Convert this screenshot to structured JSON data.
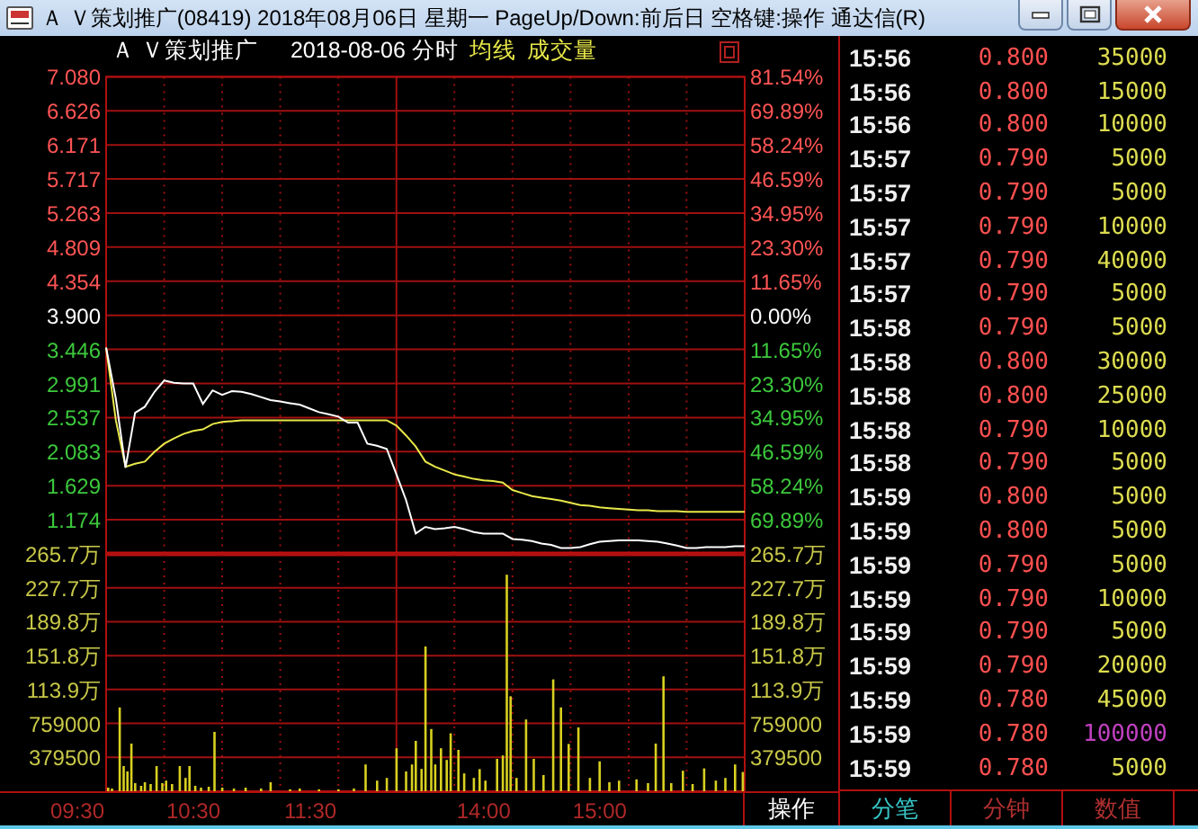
{
  "window": {
    "title": "Ａ Ｖ策划推广(08419) 2018年08月06日 星期一 PageUp/Down:前后日 空格键:操作 通达信(R)"
  },
  "chart_header": {
    "name": "Ａ Ｖ策划推广",
    "date_mode": "2018-08-06 分时"
  },
  "price_chart": {
    "chart_data": {
      "type": "line",
      "grid": true,
      "ylim": [
        0.72,
        7.08
      ],
      "categories": [
        null,
        null,
        null,
        null,
        null,
        null,
        null,
        null,
        null,
        null,
        null,
        null,
        null,
        null,
        null,
        null,
        null,
        null,
        null,
        null,
        null,
        null,
        null,
        null,
        null,
        null,
        null,
        null,
        null,
        null,
        null,
        null,
        null,
        null,
        null,
        null,
        null,
        null,
        null,
        null,
        null,
        null,
        null,
        null,
        null,
        null,
        null,
        null,
        null,
        null,
        null,
        null,
        null,
        null,
        null,
        null,
        null,
        null,
        null,
        null,
        null,
        null,
        null,
        null,
        null,
        null,
        null
      ],
      "yticks": [
        {
          "value": 7.08,
          "label": "7.080"
        },
        {
          "value": 6.626,
          "label": "6.626"
        },
        {
          "value": 6.171,
          "label": "6.171"
        },
        {
          "value": 5.717,
          "label": "5.717"
        },
        {
          "value": 5.263,
          "label": "5.263"
        },
        {
          "value": 4.809,
          "label": "4.809"
        },
        {
          "value": 4.354,
          "label": "4.354"
        },
        {
          "value": 3.9,
          "label": "3.900"
        },
        {
          "value": 3.446,
          "label": "3.446"
        },
        {
          "value": 2.991,
          "label": "2.991"
        },
        {
          "value": 2.537,
          "label": "2.537"
        },
        {
          "value": 2.083,
          "label": "2.083"
        },
        {
          "value": 1.629,
          "label": "1.629"
        },
        {
          "value": 1.174,
          "label": "1.174"
        }
      ],
      "series": [
        {
          "color": "#ffffff",
          "values": [
            3.47,
            2.79,
            1.87,
            2.6,
            2.68,
            2.88,
            3.03,
            3.0,
            2.99,
            2.99,
            2.72,
            2.9,
            2.84,
            2.89,
            2.88,
            2.85,
            2.81,
            2.77,
            2.75,
            2.73,
            2.71,
            2.66,
            2.61,
            2.58,
            2.55,
            2.47,
            2.47,
            2.19,
            2.16,
            2.12,
            1.78,
            1.44,
            0.99,
            1.08,
            1.05,
            1.06,
            1.08,
            1.05,
            1.01,
            0.99,
            0.99,
            0.99,
            0.92,
            0.91,
            0.89,
            0.86,
            0.84,
            0.8,
            0.8,
            0.81,
            0.85,
            0.88,
            0.89,
            0.9,
            0.9,
            0.9,
            0.89,
            0.88,
            0.86,
            0.83,
            0.8,
            0.8,
            0.81,
            0.81,
            0.81,
            0.82,
            0.82
          ]
        },
        {
          "name": "均线",
          "color": "#e8e84a",
          "values": [
            3.47,
            2.5,
            1.88,
            1.92,
            1.95,
            2.08,
            2.19,
            2.26,
            2.32,
            2.36,
            2.38,
            2.45,
            2.48,
            2.49,
            2.5,
            2.5,
            2.5,
            2.5,
            2.5,
            2.5,
            2.5,
            2.5,
            2.5,
            2.5,
            2.5,
            2.5,
            2.5,
            2.5,
            2.5,
            2.5,
            2.43,
            2.3,
            2.15,
            1.95,
            1.88,
            1.83,
            1.78,
            1.75,
            1.72,
            1.7,
            1.69,
            1.67,
            1.57,
            1.53,
            1.49,
            1.47,
            1.45,
            1.43,
            1.4,
            1.37,
            1.36,
            1.34,
            1.33,
            1.32,
            1.31,
            1.3,
            1.3,
            1.29,
            1.29,
            1.29,
            1.28,
            1.28,
            1.28,
            1.28,
            1.28,
            1.28,
            1.28
          ]
        }
      ]
    },
    "right_labels": [
      {
        "label": "81.54%",
        "color": "#ff5454"
      },
      {
        "label": "69.89%",
        "color": "#ff5454"
      },
      {
        "label": "58.24%",
        "color": "#ff5454"
      },
      {
        "label": "46.59%",
        "color": "#ff5454"
      },
      {
        "label": "34.95%",
        "color": "#ff5454"
      },
      {
        "label": "23.30%",
        "color": "#ff5454"
      },
      {
        "label": "11.65%",
        "color": "#ff5454"
      },
      {
        "label": "0.00%",
        "color": "#ffffff"
      },
      {
        "label": "11.65%",
        "color": "#3cc83c"
      },
      {
        "label": "23.30%",
        "color": "#3cc83c"
      },
      {
        "label": "34.95%",
        "color": "#3cc83c"
      },
      {
        "label": "46.59%",
        "color": "#3cc83c"
      },
      {
        "label": "58.24%",
        "color": "#3cc83c"
      },
      {
        "label": "69.89%",
        "color": "#3cc83c"
      }
    ]
  },
  "volume_chart": {
    "legend": "成交量",
    "left_labels": [
      "265.7万",
      "227.7万",
      "189.8万",
      "151.8万",
      "113.9万",
      "759000",
      "379500"
    ],
    "right_labels": [
      "265.7万",
      "227.7万",
      "189.8万",
      "151.8万",
      "113.9万",
      "759000",
      "379500"
    ]
  },
  "time_labels": [
    "09:30",
    "10:30",
    "11:30",
    "14:00",
    "15:00"
  ],
  "action_button": "操作",
  "trades": [
    {
      "time": "15:56",
      "price": "0.800",
      "volume": "35000",
      "color": "#dcdc50"
    },
    {
      "time": "15:56",
      "price": "0.800",
      "volume": "15000",
      "color": "#dcdc50"
    },
    {
      "time": "15:56",
      "price": "0.800",
      "volume": "10000",
      "color": "#dcdc50"
    },
    {
      "time": "15:57",
      "price": "0.790",
      "volume": "5000",
      "color": "#dcdc50"
    },
    {
      "time": "15:57",
      "price": "0.790",
      "volume": "5000",
      "color": "#dcdc50"
    },
    {
      "time": "15:57",
      "price": "0.790",
      "volume": "10000",
      "color": "#dcdc50"
    },
    {
      "time": "15:57",
      "price": "0.790",
      "volume": "40000",
      "color": "#dcdc50"
    },
    {
      "time": "15:57",
      "price": "0.790",
      "volume": "5000",
      "color": "#dcdc50"
    },
    {
      "time": "15:58",
      "price": "0.790",
      "volume": "5000",
      "color": "#dcdc50"
    },
    {
      "time": "15:58",
      "price": "0.800",
      "volume": "30000",
      "color": "#dcdc50"
    },
    {
      "time": "15:58",
      "price": "0.800",
      "volume": "25000",
      "color": "#dcdc50"
    },
    {
      "time": "15:58",
      "price": "0.790",
      "volume": "10000",
      "color": "#dcdc50"
    },
    {
      "time": "15:58",
      "price": "0.790",
      "volume": "5000",
      "color": "#dcdc50"
    },
    {
      "time": "15:59",
      "price": "0.800",
      "volume": "5000",
      "color": "#dcdc50"
    },
    {
      "time": "15:59",
      "price": "0.800",
      "volume": "5000",
      "color": "#dcdc50"
    },
    {
      "time": "15:59",
      "price": "0.790",
      "volume": "5000",
      "color": "#dcdc50"
    },
    {
      "time": "15:59",
      "price": "0.790",
      "volume": "10000",
      "color": "#dcdc50"
    },
    {
      "time": "15:59",
      "price": "0.790",
      "volume": "5000",
      "color": "#dcdc50"
    },
    {
      "time": "15:59",
      "price": "0.790",
      "volume": "20000",
      "color": "#dcdc50"
    },
    {
      "time": "15:59",
      "price": "0.780",
      "volume": "45000",
      "color": "#dcdc50"
    },
    {
      "time": "15:59",
      "price": "0.780",
      "volume": "100000",
      "color": "#c040c0"
    },
    {
      "time": "15:59",
      "price": "0.780",
      "volume": "5000",
      "color": "#dcdc50"
    }
  ],
  "trade_tabs": [
    {
      "label": "分笔",
      "selected": true
    },
    {
      "label": "分钟",
      "selected": false
    },
    {
      "label": "数值",
      "selected": false
    }
  ]
}
